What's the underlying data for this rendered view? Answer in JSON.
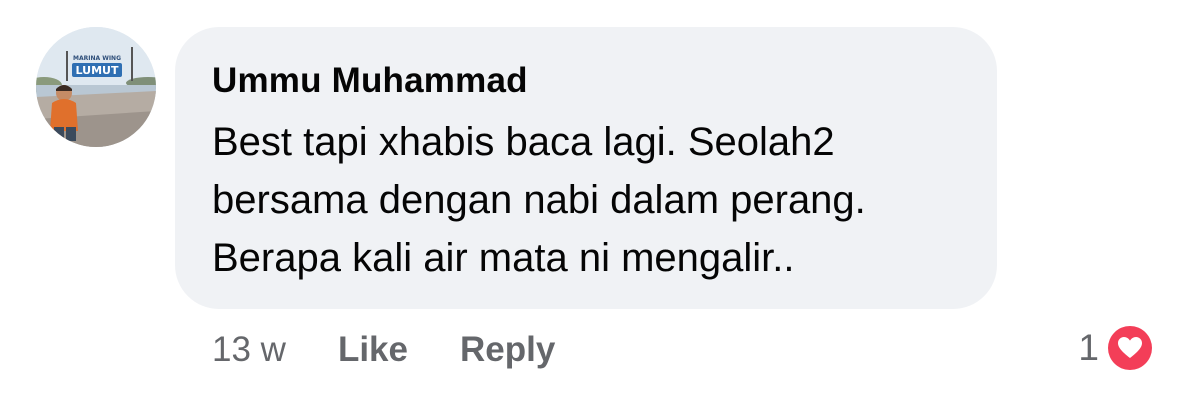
{
  "comment": {
    "author": "Ummu Muhammad",
    "text_lines": [
      "Best tapi xhabis baca lagi. Seolah2",
      "bersama dengan nabi dalam perang.",
      "Berapa kali air mata ni mengalir.."
    ],
    "avatar_sign_top": "MARINA WING",
    "avatar_sign_main": "LUMUT"
  },
  "actions": {
    "time": "13 w",
    "like_label": "Like",
    "reply_label": "Reply"
  },
  "reactions": {
    "count": "1",
    "icon": "heart-reaction-icon",
    "color": "#f33e58"
  },
  "colors": {
    "bubble": "#f0f2f5",
    "text": "#050505",
    "secondary": "#65676b"
  }
}
